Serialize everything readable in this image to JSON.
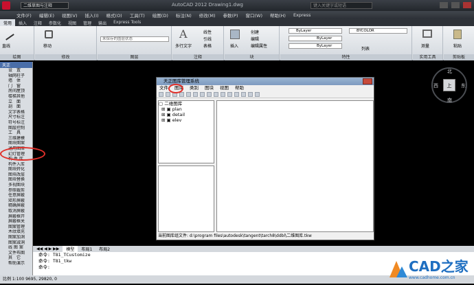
{
  "app": {
    "title": "AutoCAD 2012  Drawing1.dwg",
    "workspace": "二维草图与注释",
    "search_placeholder": "键入关键字或短语"
  },
  "menubar": [
    "文件(F)",
    "编辑(E)",
    "视图(V)",
    "插入(I)",
    "格式(O)",
    "工具(T)",
    "绘图(D)",
    "标注(N)",
    "修改(M)",
    "参数(P)",
    "窗口(W)",
    "帮助(H)",
    "Express"
  ],
  "ribbon_tabs": [
    "常用",
    "插入",
    "注释",
    "参数化",
    "视图",
    "管理",
    "输出",
    "Express Tools"
  ],
  "ribbon_panels": {
    "draw": "绘图",
    "modify": "修改",
    "layers": "图层",
    "annotation": "注释",
    "block": "块",
    "properties": "特性",
    "utilities": "实用工具",
    "clipboard": "剪贴板",
    "line": "直线",
    "move": "移动",
    "multiline_text": "多行文字",
    "insert": "插入",
    "bylayer1": "ByLayer",
    "bylayer2": "ByLayer",
    "bylayer3": "ByLayer",
    "bycolor": "BYCOLOR",
    "linear": "线性",
    "leader": "引线",
    "table": "表格",
    "create": "创建",
    "edit": "编辑",
    "edit_attr": "编辑属性",
    "unsaved_layer": "未保存的图层状态",
    "list": "列表",
    "measure": "测量",
    "paste": "粘贴"
  },
  "left_palette": {
    "header": "天正",
    "items": [
      "设　置",
      "轴网柱子",
      "墙　体",
      "门　窗",
      "房间屋顶",
      "楼梯其他",
      "立　面",
      "剖　面",
      "文字表格",
      "尺寸标注",
      "符号标注",
      "图层控制",
      "工　具",
      "三维建模",
      "图块图案",
      "通用图库",
      "幻灯管理",
      "构 件 库",
      "构件入库",
      "图块转化",
      "图块改层",
      "图块替换",
      "多视图块",
      "参照裁剪",
      "任意屏蔽",
      "矩形屏蔽",
      "精确屏蔽",
      "取消屏蔽",
      "屏蔽框开",
      "屏蔽框关",
      "图案管理",
      "木纹填充",
      "图案加洞",
      "图案减洞",
      "线 图 案",
      "文件布图",
      "其　它",
      "帮助演示"
    ]
  },
  "dialog": {
    "title": "天正图库管理系统",
    "menu": [
      "文件",
      "图库",
      "类别",
      "图块",
      "视图",
      "帮助"
    ],
    "tree_root": "二维图库",
    "tree_items": [
      "plan",
      "detail",
      "elev"
    ],
    "status": "当前图库组文件: d:\\program files\\autodesk\\tangent\\tarch8\\ddbl\\二维图库.tkw"
  },
  "layout_tabs": [
    "模型",
    "布局1",
    "布局2"
  ],
  "command_lines": [
    "命令: T81_TCustomize",
    "命令: T81_tkw",
    "命令:"
  ],
  "statusbar": "比例 1:100  9695, 29820, 0",
  "viewcube": {
    "n": "北",
    "s": "南",
    "w": "西",
    "e": "东",
    "top": "上"
  },
  "watermark": {
    "text": "CAD之家",
    "url": "www.cadhome.com.cn"
  },
  "colors": {
    "accent": "#4a6ea8",
    "highlight_ring": "#e0302a",
    "canvas": "#000000"
  }
}
